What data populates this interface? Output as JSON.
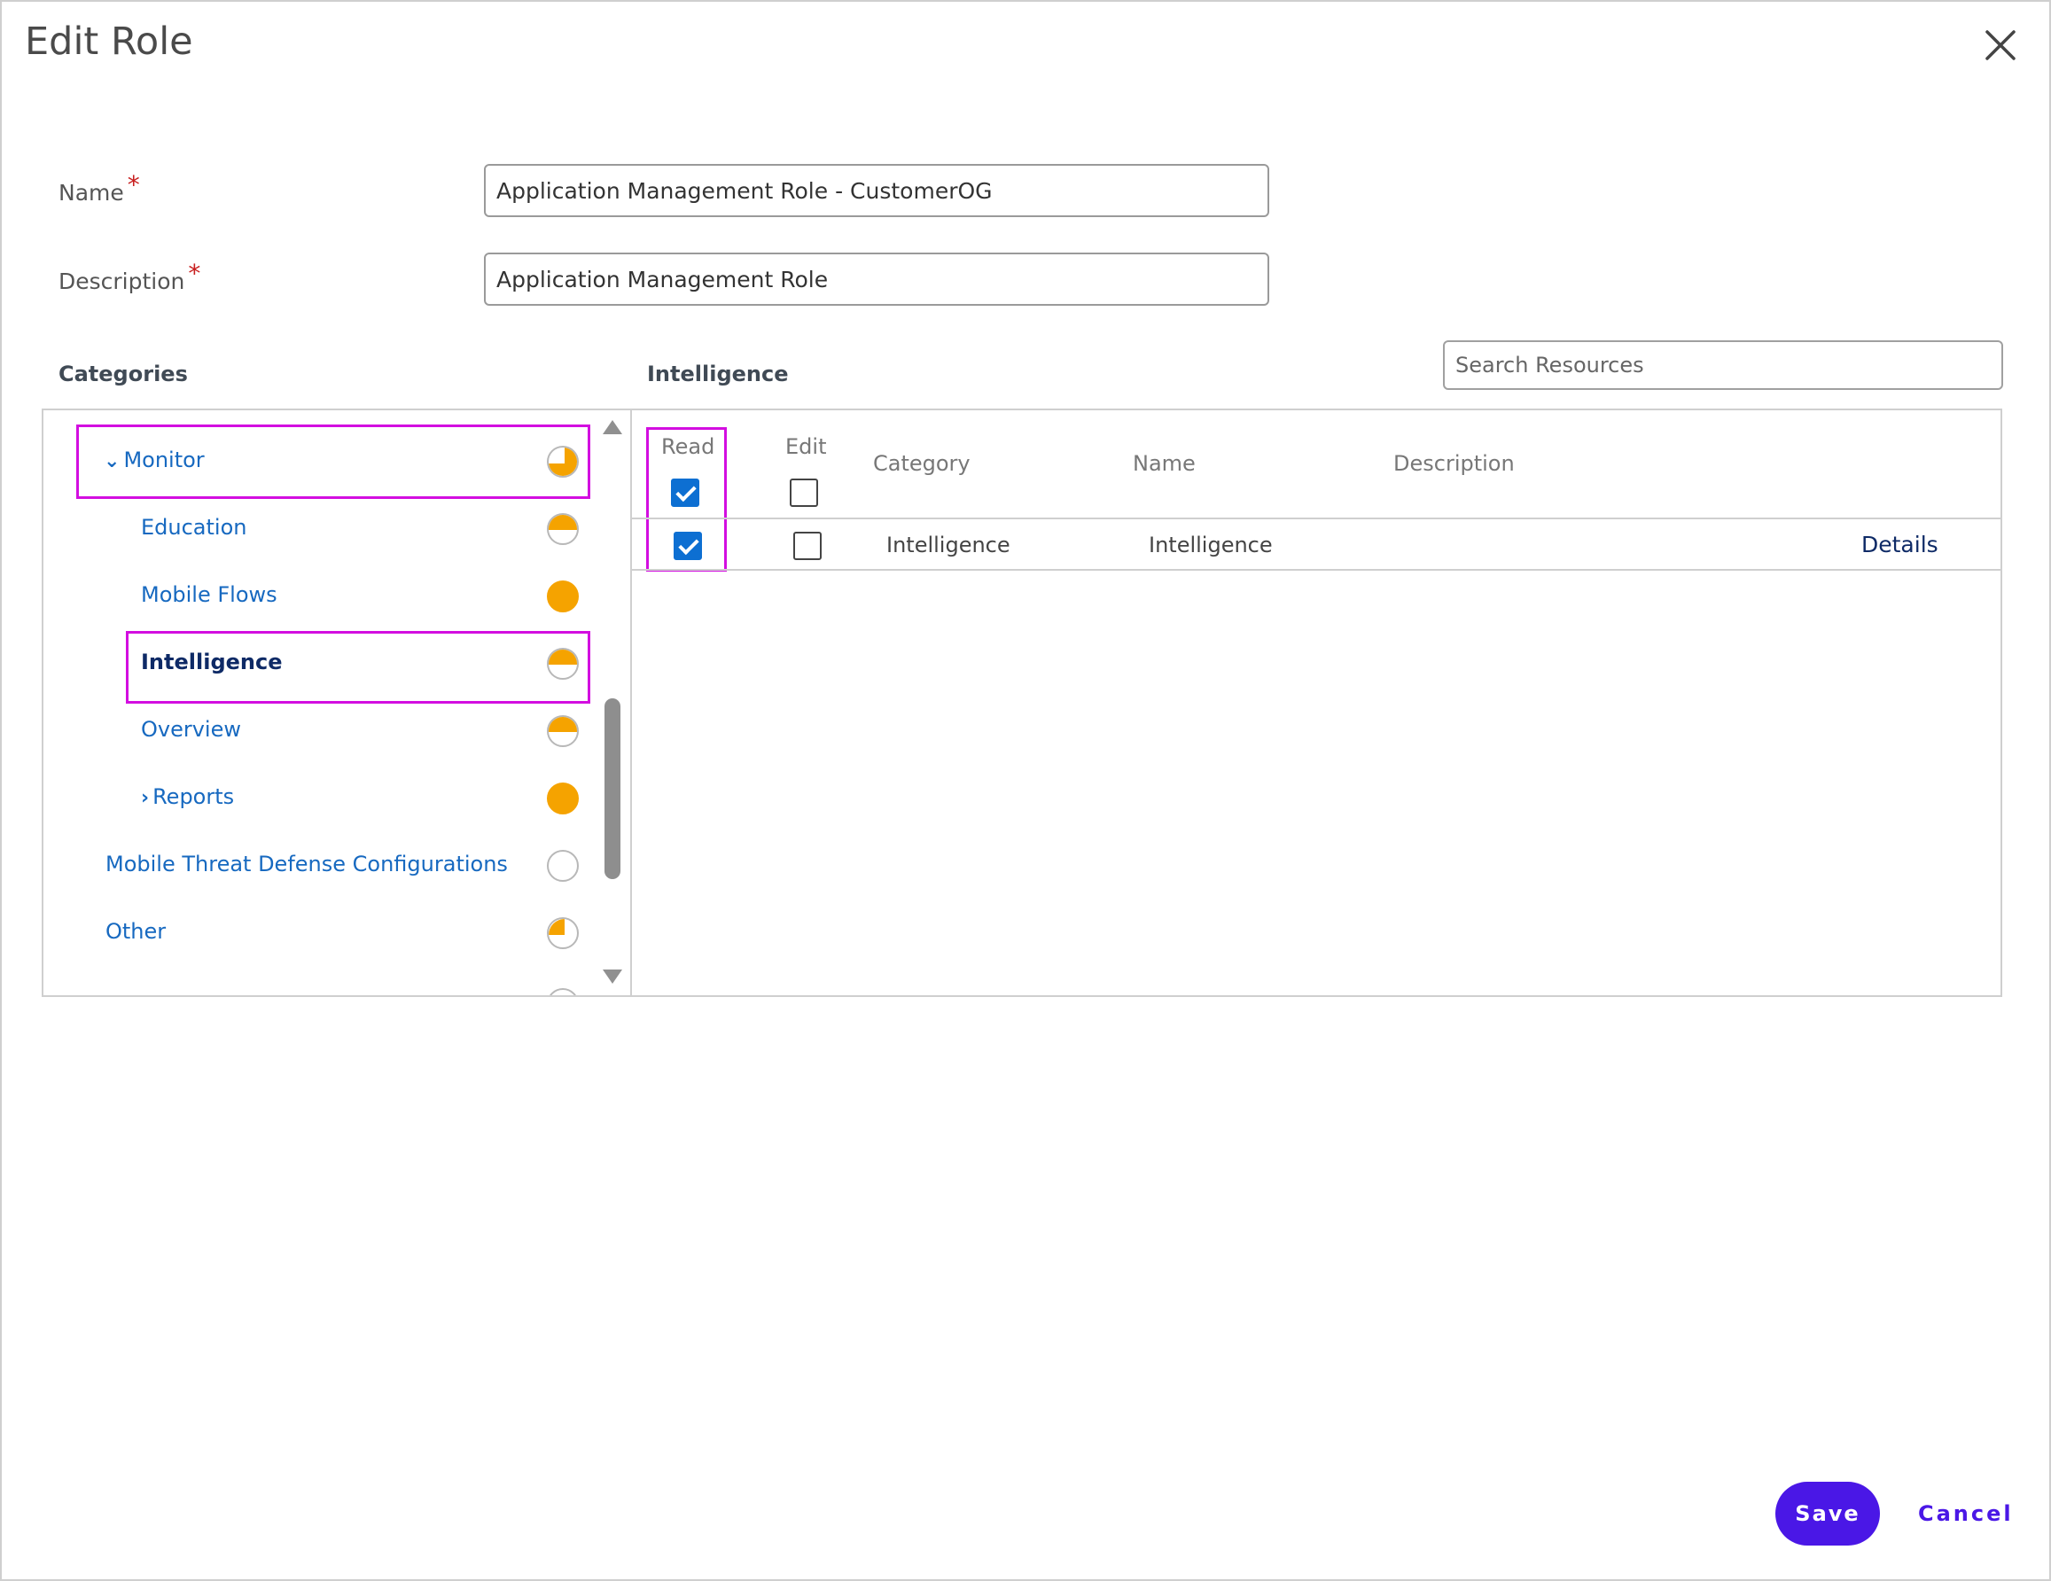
{
  "dialog": {
    "title": "Edit Role",
    "close_icon": "close-icon"
  },
  "form": {
    "name_label": "Name",
    "name_value": "Application Management Role - CustomerOG",
    "description_label": "Description",
    "description_value": "Application Management Role",
    "required_marker": "*"
  },
  "categories": {
    "heading": "Categories",
    "items": [
      {
        "label": "Monitor",
        "expanded": true,
        "indent": 1,
        "pie": "three-quarter"
      },
      {
        "label": "Education",
        "indent": 2,
        "pie": "half"
      },
      {
        "label": "Mobile Flows",
        "indent": 2,
        "pie": "full"
      },
      {
        "label": "Intelligence",
        "indent": 2,
        "pie": "half",
        "selected": true
      },
      {
        "label": "Overview",
        "indent": 2,
        "pie": "half"
      },
      {
        "label": "Reports",
        "collapsed": true,
        "indent": 2,
        "pie": "full"
      },
      {
        "label": "Mobile Threat Defense Configurations",
        "indent": 1,
        "pie": "empty"
      },
      {
        "label": "Other",
        "indent": 1,
        "pie": "quarter"
      }
    ]
  },
  "resources": {
    "heading": "Intelligence",
    "search_placeholder": "Search Resources",
    "columns": {
      "read": "Read",
      "edit": "Edit",
      "category": "Category",
      "name": "Name",
      "description": "Description"
    },
    "header_read_checked": true,
    "header_edit_checked": false,
    "rows": [
      {
        "read": true,
        "edit": false,
        "category": "Intelligence",
        "name": "Intelligence",
        "description": "",
        "action": "Details"
      }
    ]
  },
  "footer": {
    "save_label": "Save",
    "cancel_label": "Cancel"
  },
  "colors": {
    "accent": "#4a17e6",
    "link": "#1769c0",
    "pie": "#f5a300",
    "highlight": "#d30ee0",
    "checkbox": "#0d6fd2"
  }
}
